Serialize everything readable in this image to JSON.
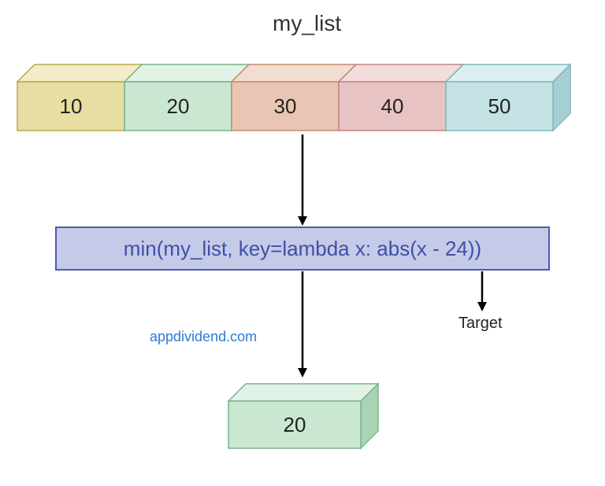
{
  "title": "my_list",
  "cells": [
    {
      "value": "10",
      "fill": "#e8dea3",
      "side": "#d6c773",
      "top": "#f2ecc9",
      "stroke": "#b8a94a"
    },
    {
      "value": "20",
      "fill": "#c9e7d1",
      "side": "#a9d3b5",
      "top": "#e1f2e6",
      "stroke": "#7ab48a"
    },
    {
      "value": "30",
      "fill": "#e9c6b3",
      "side": "#dcae96",
      "top": "#f2ddd1",
      "stroke": "#c58d6f"
    },
    {
      "value": "40",
      "fill": "#e7c3c3",
      "side": "#d9a6a6",
      "top": "#f2dcdc",
      "stroke": "#c58484"
    },
    {
      "value": "50",
      "fill": "#c4e1e4",
      "side": "#a6cfd4",
      "top": "#ddeef0",
      "stroke": "#7eb8bf"
    }
  ],
  "code": "min(my_list, key=lambda x: abs(x - 24))",
  "watermark": "appdividend.com",
  "target_label": "Target",
  "result": {
    "value": "20",
    "fill": "#c9e7d1",
    "side": "#a9d3b5",
    "top": "#e1f2e6",
    "stroke": "#7ab48a"
  }
}
